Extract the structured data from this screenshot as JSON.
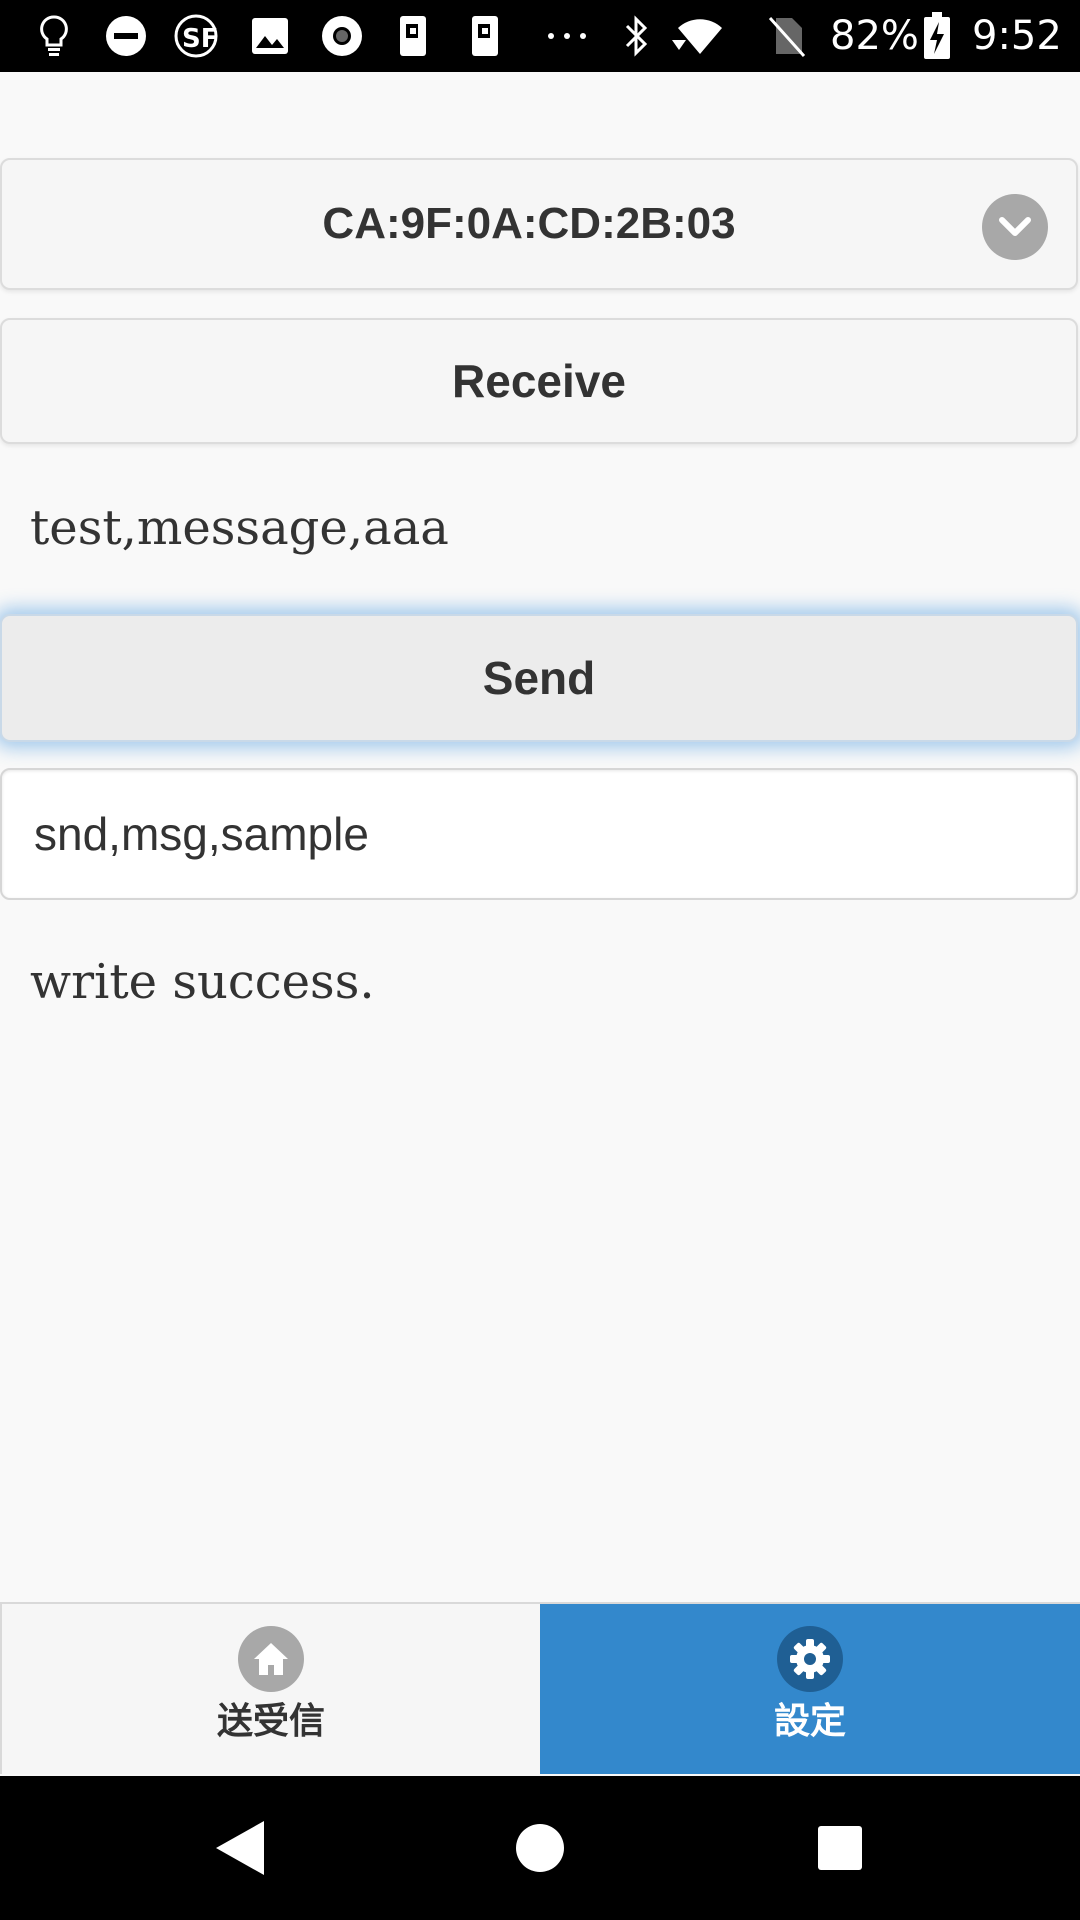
{
  "status_bar": {
    "battery": "82%",
    "time": "9:52",
    "icons": [
      "lightbulb-icon",
      "do-not-disturb-icon",
      "sf-app-icon",
      "image-icon",
      "record-icon",
      "nfc-card-icon",
      "nfc-card-icon",
      "more-icon",
      "bluetooth-icon",
      "wifi-icon",
      "no-sim-icon",
      "battery-charging-icon"
    ]
  },
  "device_select": {
    "value": "CA:9F:0A:CD:2B:03"
  },
  "receive": {
    "button_label": "Receive",
    "received_text": "test,message,aaa"
  },
  "send": {
    "button_label": "Send",
    "input_value": "snd,msg,sample",
    "status_text": "write success."
  },
  "tabs": [
    {
      "label": "送受信",
      "icon": "home-icon",
      "active": false
    },
    {
      "label": "設定",
      "icon": "gear-icon",
      "active": true
    }
  ],
  "colors": {
    "accent": "#3388cc",
    "status_bar": "#000000",
    "background": "#f9f9f9"
  }
}
